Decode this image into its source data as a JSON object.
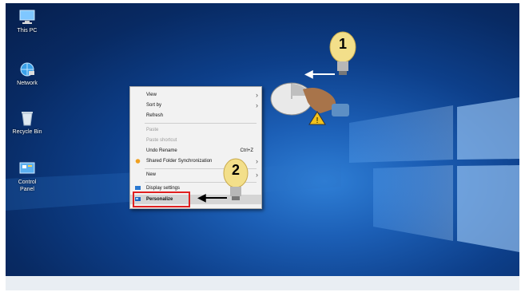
{
  "desktop": {
    "icons": [
      {
        "label": "This PC",
        "icon": "computer-icon"
      },
      {
        "label": "Network",
        "icon": "network-icon"
      },
      {
        "label": "Recycle Bin",
        "icon": "recycle-bin-icon"
      },
      {
        "label": "Control Panel",
        "icon": "control-panel-icon"
      }
    ]
  },
  "context_menu": {
    "items": [
      {
        "label": "View",
        "submenu": true
      },
      {
        "label": "Sort by",
        "submenu": true
      },
      {
        "label": "Refresh"
      },
      {
        "label": "Paste",
        "disabled": true
      },
      {
        "label": "Paste shortcut",
        "disabled": true
      },
      {
        "label": "Undo Rename",
        "shortcut": "Ctrl+Z"
      },
      {
        "label": "Shared Folder Synchronization",
        "submenu": true,
        "icon": "sync-icon"
      },
      {
        "label": "New",
        "submenu": true
      },
      {
        "label": "Display settings",
        "icon": "display-icon"
      },
      {
        "label": "Personalize",
        "icon": "personalize-icon",
        "highlighted": true
      }
    ]
  },
  "annotations": {
    "step1": "1",
    "step2": "2"
  },
  "colors": {
    "highlight_box": "#e02020",
    "bulb": "#f3df8a",
    "desktop": "#0d3f8a"
  }
}
